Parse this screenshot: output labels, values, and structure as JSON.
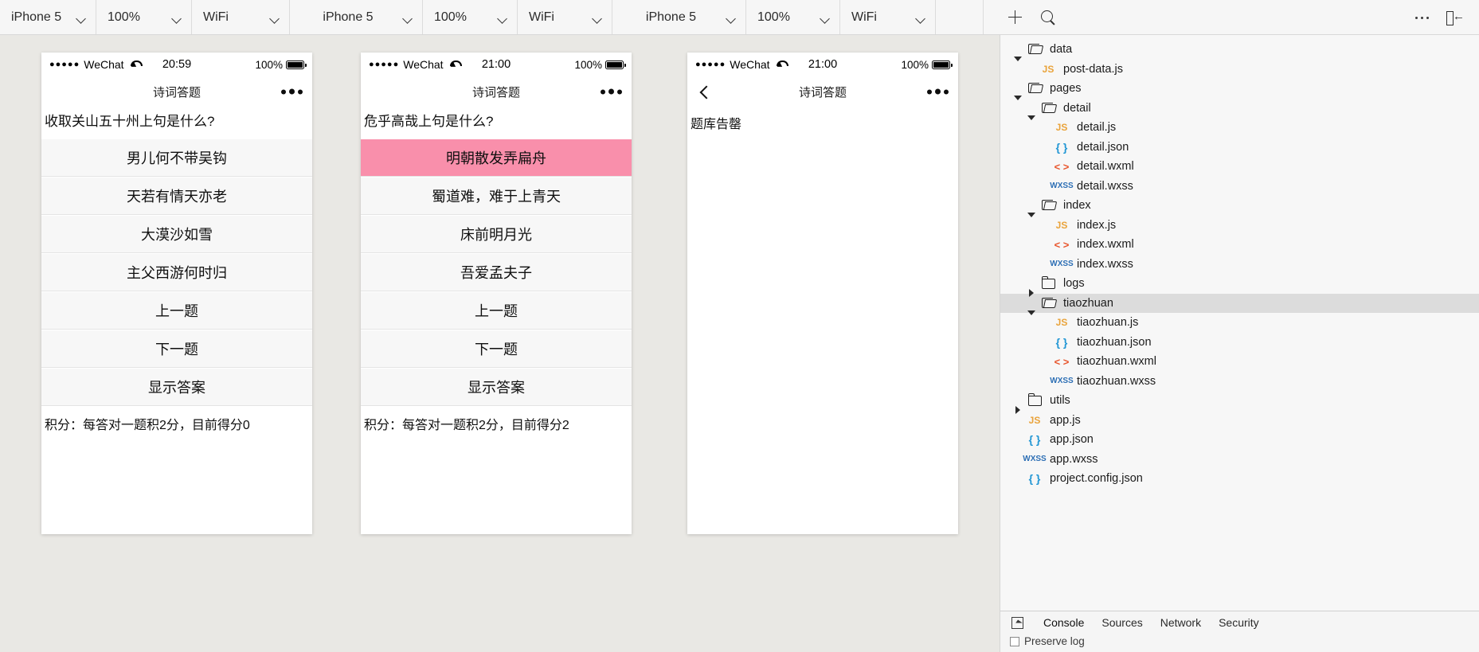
{
  "toolbar": {
    "selectors": [
      {
        "label": "iPhone 5",
        "name": "device-selector-1"
      },
      {
        "label": "100%",
        "name": "zoom-selector-1"
      },
      {
        "label": "WiFi",
        "name": "network-selector-1"
      },
      {
        "label": "iPhone 5",
        "name": "device-selector-2"
      },
      {
        "label": "100%",
        "name": "zoom-selector-2"
      },
      {
        "label": "WiFi",
        "name": "network-selector-2"
      },
      {
        "label": "iPhone 5",
        "name": "device-selector-3"
      },
      {
        "label": "100%",
        "name": "zoom-selector-3"
      },
      {
        "label": "WiFi",
        "name": "network-selector-3"
      }
    ],
    "add_icon": "plus-icon",
    "search_icon": "search-icon",
    "more_icon": "more-options-icon",
    "dock_icon": "dock-panel-icon"
  },
  "phones": [
    {
      "name": "simulator-1",
      "status": {
        "carrier": "WeChat",
        "dots": "●●●●●",
        "time": "20:59",
        "battery": "100%"
      },
      "nav": {
        "title": "诗词答题",
        "has_back": false
      },
      "question": "收取关山五十州上句是什么?",
      "options": [
        {
          "label": "男儿何不带吴钩",
          "selected": false
        },
        {
          "label": "天若有情天亦老",
          "selected": false
        },
        {
          "label": "大漠沙如雪",
          "selected": false
        },
        {
          "label": "主父西游何时归",
          "selected": false
        },
        {
          "label": "上一题",
          "selected": false
        },
        {
          "label": "下一题",
          "selected": false
        },
        {
          "label": "显示答案",
          "selected": false
        }
      ],
      "score": "积分：每答对一题积2分，目前得分0"
    },
    {
      "name": "simulator-2",
      "status": {
        "carrier": "WeChat",
        "dots": "●●●●●",
        "time": "21:00",
        "battery": "100%"
      },
      "nav": {
        "title": "诗词答题",
        "has_back": false
      },
      "question": "危乎高哉上句是什么?",
      "options": [
        {
          "label": "明朝散发弄扁舟",
          "selected": true
        },
        {
          "label": "蜀道难，难于上青天",
          "selected": false
        },
        {
          "label": "床前明月光",
          "selected": false
        },
        {
          "label": "吾爱孟夫子",
          "selected": false
        },
        {
          "label": "上一题",
          "selected": false
        },
        {
          "label": "下一题",
          "selected": false
        },
        {
          "label": "显示答案",
          "selected": false
        }
      ],
      "score": "积分：每答对一题积2分，目前得分2"
    },
    {
      "name": "simulator-3",
      "status": {
        "carrier": "WeChat",
        "dots": "●●●●●",
        "time": "21:00",
        "battery": "100%"
      },
      "nav": {
        "title": "诗词答题",
        "has_back": true
      },
      "empty_message": "题库告罄"
    }
  ],
  "selected_option_color": "#f98fab",
  "file_tree": [
    {
      "label": "data",
      "kind": "folder",
      "state": "open",
      "depth": 0,
      "active": false
    },
    {
      "label": "post-data.js",
      "kind": "js",
      "depth": 1,
      "active": false
    },
    {
      "label": "pages",
      "kind": "folder",
      "state": "open",
      "depth": 0,
      "active": false
    },
    {
      "label": "detail",
      "kind": "folder",
      "state": "open",
      "depth": 1,
      "active": false
    },
    {
      "label": "detail.js",
      "kind": "js",
      "depth": 2,
      "active": false
    },
    {
      "label": "detail.json",
      "kind": "json",
      "depth": 2,
      "active": false
    },
    {
      "label": "detail.wxml",
      "kind": "wxml",
      "depth": 2,
      "active": false
    },
    {
      "label": "detail.wxss",
      "kind": "wxss",
      "depth": 2,
      "active": false
    },
    {
      "label": "index",
      "kind": "folder",
      "state": "open",
      "depth": 1,
      "active": false
    },
    {
      "label": "index.js",
      "kind": "js",
      "depth": 2,
      "active": false
    },
    {
      "label": "index.wxml",
      "kind": "wxml",
      "depth": 2,
      "active": false
    },
    {
      "label": "index.wxss",
      "kind": "wxss",
      "depth": 2,
      "active": false
    },
    {
      "label": "logs",
      "kind": "folder",
      "state": "closed",
      "depth": 1,
      "active": false
    },
    {
      "label": "tiaozhuan",
      "kind": "folder",
      "state": "open",
      "depth": 1,
      "active": true
    },
    {
      "label": "tiaozhuan.js",
      "kind": "js",
      "depth": 2,
      "active": false
    },
    {
      "label": "tiaozhuan.json",
      "kind": "json",
      "depth": 2,
      "active": false
    },
    {
      "label": "tiaozhuan.wxml",
      "kind": "wxml",
      "depth": 2,
      "active": false
    },
    {
      "label": "tiaozhuan.wxss",
      "kind": "wxss",
      "depth": 2,
      "active": false
    },
    {
      "label": "utils",
      "kind": "folder",
      "state": "closed",
      "depth": 0,
      "active": false
    },
    {
      "label": "app.js",
      "kind": "js",
      "depth": 0,
      "active": false
    },
    {
      "label": "app.json",
      "kind": "json",
      "depth": 0,
      "active": false
    },
    {
      "label": "app.wxss",
      "kind": "wxss",
      "depth": 0,
      "active": false
    },
    {
      "label": "project.config.json",
      "kind": "json",
      "depth": 0,
      "active": false
    }
  ],
  "devtools_bottom": {
    "inspect_icon": "inspect-element-icon",
    "tabs": [
      {
        "label": "Console",
        "active": true
      },
      {
        "label": "Sources",
        "active": false
      },
      {
        "label": "Network",
        "active": false
      },
      {
        "label": "Security",
        "active": false
      }
    ],
    "preserve_log_label": "Preserve log"
  }
}
